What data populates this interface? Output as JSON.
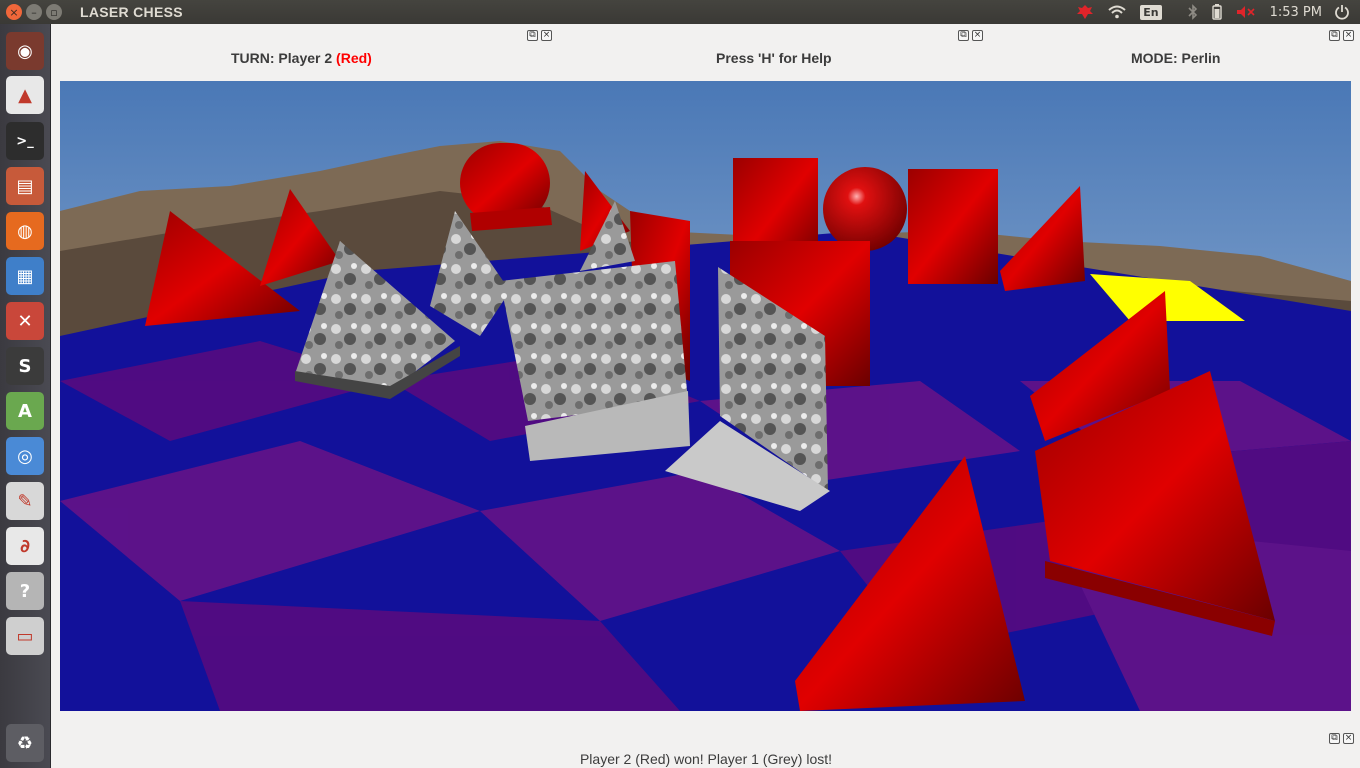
{
  "window": {
    "title": "LASER CHESS",
    "close_glyph": "×",
    "minimize_glyph": "–",
    "maximize_glyph": "▫"
  },
  "indicators": {
    "language": "En",
    "clock": "1:53 PM"
  },
  "launcher": {
    "items": [
      {
        "name": "ubuntu-dash-icon",
        "glyph": "◉",
        "bg": "#7a3a2e"
      },
      {
        "name": "vlc-icon",
        "glyph": "▲",
        "bg": "#e8e8e8"
      },
      {
        "name": "terminal-icon",
        "glyph": ">_",
        "bg": "#2d2d2d"
      },
      {
        "name": "files-icon",
        "glyph": "▤",
        "bg": "#c75a3a"
      },
      {
        "name": "firefox-icon",
        "glyph": "◍",
        "bg": "#e66a1f"
      },
      {
        "name": "writer-icon",
        "glyph": "▦",
        "bg": "#3f7fc9"
      },
      {
        "name": "settings-icon",
        "glyph": "✕",
        "bg": "#c9473a"
      },
      {
        "name": "sublime-icon",
        "glyph": "S",
        "bg": "#3b3b3b"
      },
      {
        "name": "android-studio-icon",
        "glyph": "A",
        "bg": "#6aa84f"
      },
      {
        "name": "chromium-icon",
        "glyph": "◎",
        "bg": "#4a8ad6"
      },
      {
        "name": "text-editor-icon",
        "glyph": "✎",
        "bg": "#d8d8d8"
      },
      {
        "name": "pdf-reader-icon",
        "glyph": "∂",
        "bg": "#e8e8e8"
      },
      {
        "name": "help-icon",
        "glyph": "?",
        "bg": "#b5b5b5"
      },
      {
        "name": "drive-icon",
        "glyph": "▭",
        "bg": "#cfcfcf"
      },
      {
        "name": "trash-icon",
        "glyph": "♻",
        "bg": "#5d5d63"
      }
    ]
  },
  "panels": {
    "turn": {
      "prefix": "TURN: Player 2 ",
      "player": "(Red)",
      "player_color": "#ff0000"
    },
    "help": {
      "text": "Press 'H' for Help"
    },
    "mode": {
      "text": "MODE: Perlin"
    },
    "restore_glyph": "⧉",
    "close_glyph": "×"
  },
  "status": {
    "text": "Player 2 (Red)  won! Player 1 (Grey)  lost!"
  }
}
